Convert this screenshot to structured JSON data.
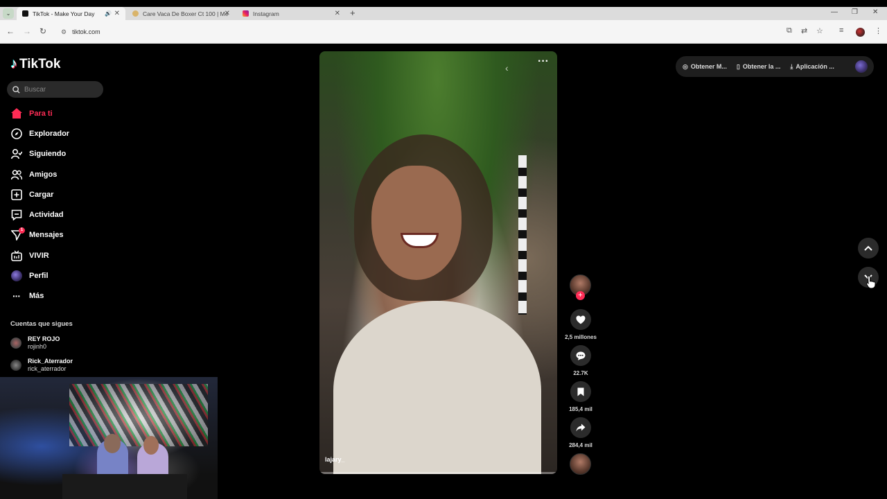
{
  "browser": {
    "tabs": [
      {
        "title": "TikTok - Make Your Day",
        "active": true
      },
      {
        "title": "Care Vaca De Boxer Ct 100 | Me",
        "active": false
      },
      {
        "title": "Instagram",
        "active": false
      }
    ],
    "url": "tiktok.com"
  },
  "sidebar": {
    "logo": "TikTok",
    "search_placeholder": "Buscar",
    "items": [
      {
        "label": "Para ti",
        "icon": "home-icon",
        "active": true
      },
      {
        "label": "Explorador",
        "icon": "compass-icon"
      },
      {
        "label": "Siguiendo",
        "icon": "following-icon"
      },
      {
        "label": "Amigos",
        "icon": "friends-icon"
      },
      {
        "label": "Cargar",
        "icon": "upload-icon"
      },
      {
        "label": "Actividad",
        "icon": "activity-icon"
      },
      {
        "label": "Mensajes",
        "icon": "messages-icon",
        "badge": "1"
      },
      {
        "label": "VIVIR",
        "icon": "live-icon"
      },
      {
        "label": "Perfil",
        "icon": "profile-avatar"
      },
      {
        "label": "Más",
        "icon": "more-icon"
      }
    ],
    "following_title": "Cuentas que sigues",
    "following": [
      {
        "name": "REY ROJO",
        "handle": "rojinh0"
      },
      {
        "name": "Rick_Aterrador",
        "handle": "rick_aterrador"
      }
    ]
  },
  "video": {
    "author": "lajary_"
  },
  "actions": {
    "likes": "2,5 millones",
    "comments": "22.7K",
    "saves": "185,4 mil",
    "shares": "284,4 mil"
  },
  "topbar": {
    "item1": "Obtener M...",
    "item2": "Obtener la ...",
    "item3": "Aplicación ..."
  },
  "colors": {
    "accent": "#fe2c55",
    "background": "#000000"
  }
}
